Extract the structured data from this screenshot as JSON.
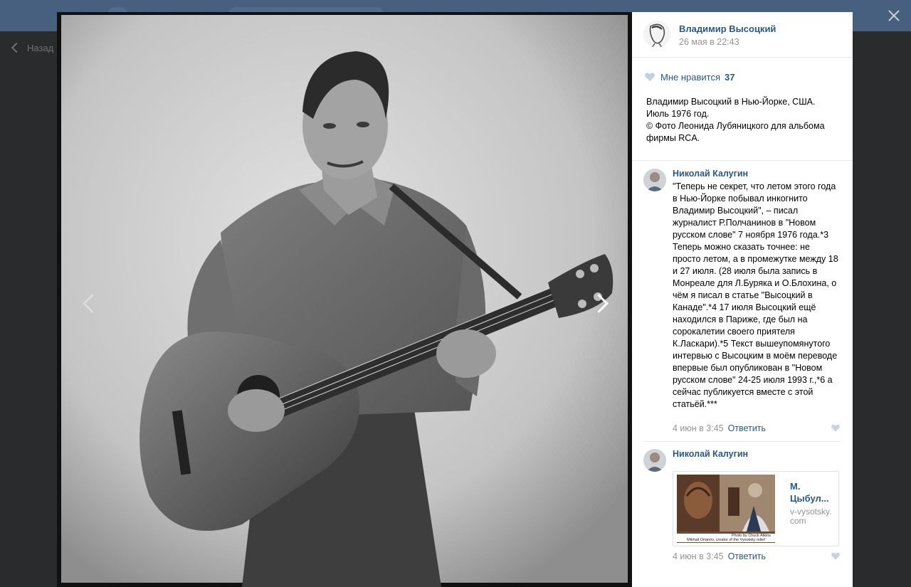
{
  "background": {
    "back_label": "Назад"
  },
  "post": {
    "author_name": "Владимир Высоцкий",
    "date": "26 мая в 22:43",
    "likes_label": "Мне нравится",
    "likes_count": "37",
    "caption_lines": [
      "Владимир Высоцкий в Нью-Йорке, США.",
      "Июль 1976 год.",
      "© Фото Леонида Лубяницкого для альбома фирмы RCA."
    ]
  },
  "comments": [
    {
      "author": "Николай Калугин",
      "text": "\"Теперь не секрет, что летом этого года в Нью-Йорке побывал инкогнито Владимир Высоцкий\", – писал журналист Р.Полчанинов в \"Новом русском слове\" 7 ноября 1976 года.*3 Теперь можно сказать точнее: не просто летом, а в промежутке между 18 и 27 июля. (28 июля была запись в Монреале для Л.Буряка и О.Блохина, о чём я писал в статье \"Высоцкий в Канаде\".*4 17 июля Высоцкий ещё находился в Париже, где был на сорокалетии своего приятеля К.Ласкари).*5 Текст вышеупомянутого интервью с Высоцким в моём переводе впервые был опубликован в \"Новом русском слове\" 24-25 июля 1993 г.,*6 а сейчас публикуется вместе с этой статьёй.***",
      "date": "4 июн в 3:45",
      "reply": "Ответить"
    },
    {
      "author": "Николай Калугин",
      "date": "4 июн в 3:45",
      "reply": "Ответить",
      "link": {
        "title": "М. Цыбул...",
        "domain": "v-vysotsky.com",
        "image_caption_1": "Photo by Chuck Atkins",
        "image_caption_2": "Mikhail Orianov, creator of the Vysotsky relief"
      }
    }
  ]
}
